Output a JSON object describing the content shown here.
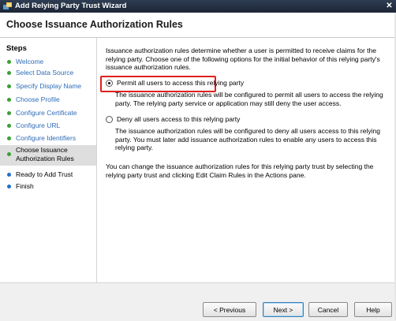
{
  "window": {
    "title": "Add Relying Party Trust Wizard",
    "close_glyph": "✕"
  },
  "header": {
    "title": "Choose Issuance Authorization Rules"
  },
  "steps": {
    "title": "Steps",
    "items": [
      {
        "label": "Welcome",
        "state": "done"
      },
      {
        "label": "Select Data Source",
        "state": "done"
      },
      {
        "label": "Specify Display Name",
        "state": "done"
      },
      {
        "label": "Choose Profile",
        "state": "done"
      },
      {
        "label": "Configure Certificate",
        "state": "done"
      },
      {
        "label": "Configure URL",
        "state": "done"
      },
      {
        "label": "Configure Identifiers",
        "state": "done"
      },
      {
        "label": "Choose Issuance Authorization Rules",
        "state": "current"
      },
      {
        "label": "Ready to Add Trust",
        "state": "todo"
      },
      {
        "label": "Finish",
        "state": "todo"
      }
    ]
  },
  "main": {
    "intro": "Issuance authorization rules determine whether a user is permitted to receive claims for the relying party. Choose one of the following options for the initial behavior of this relying party's issuance authorization rules.",
    "option_permit": {
      "label": "Permit all users to access this relying party",
      "description": "The issuance authorization rules will be configured to permit all users to access the relying party. The relying party service or application may still deny the user access.",
      "checked": true
    },
    "option_deny": {
      "label": "Deny all users access to this relying party",
      "description": "The issuance authorization rules will be configured to deny all users access to this relying party. You must later add issuance authorization rules to enable any users to access this relying party.",
      "checked": false
    },
    "note": "You can change the issuance authorization rules for this relying party trust by selecting the relying party trust and clicking Edit Claim Rules in the Actions pane."
  },
  "footer": {
    "previous_label": "< Previous",
    "next_label": "Next >",
    "cancel_label": "Cancel",
    "help_label": "Help"
  },
  "colors": {
    "highlight": "#e02020",
    "done_dot": "#3aa035",
    "todo_dot": "#1f6fcf",
    "link": "#2f6cb6"
  }
}
